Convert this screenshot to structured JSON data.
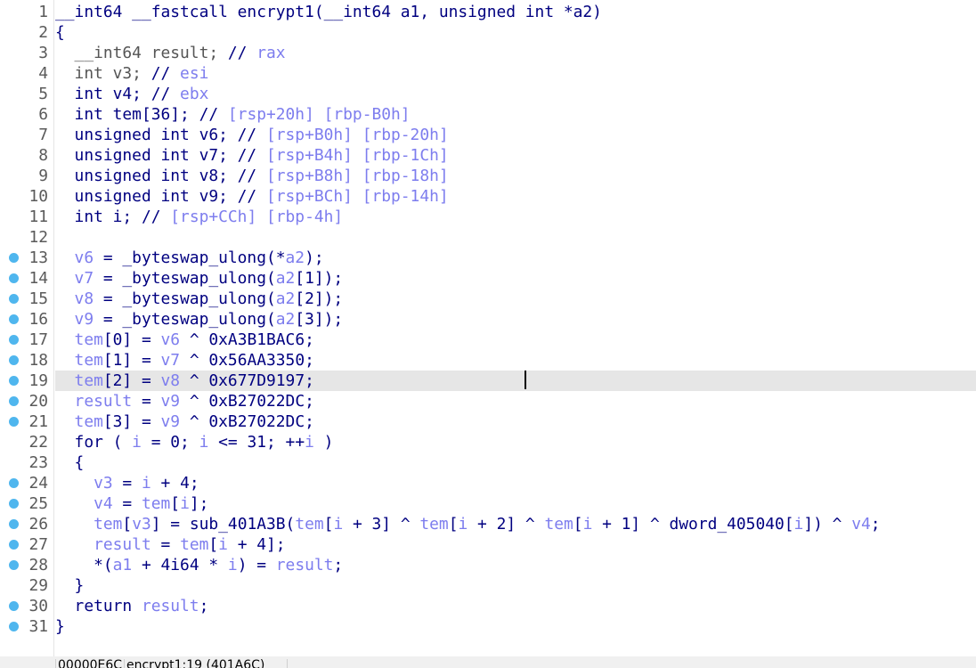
{
  "colors": {
    "code": "#000080",
    "variable": "#7d7dee",
    "line_number": "#5a5a5a",
    "breakpoint": "#4fb6ee",
    "highlight": "#e6e6e6"
  },
  "highlighted_line": 19,
  "lines": [
    {
      "n": "1",
      "dot": false,
      "t": [
        [
          "__int64 __fastcall encrypt1(__int64 a1, unsigned int *a2)",
          "k"
        ]
      ]
    },
    {
      "n": "2",
      "dot": false,
      "t": [
        [
          "{",
          "k"
        ]
      ]
    },
    {
      "n": "3",
      "dot": false,
      "t": [
        [
          "  __int64 result; ",
          "g"
        ],
        [
          "// ",
          "k"
        ],
        [
          "rax",
          "c"
        ]
      ]
    },
    {
      "n": "4",
      "dot": false,
      "t": [
        [
          "  int v3; ",
          "g"
        ],
        [
          "// ",
          "k"
        ],
        [
          "esi",
          "c"
        ]
      ]
    },
    {
      "n": "5",
      "dot": false,
      "t": [
        [
          "  int v4; ",
          "k"
        ],
        [
          "// ",
          "k"
        ],
        [
          "ebx",
          "c"
        ]
      ]
    },
    {
      "n": "6",
      "dot": false,
      "t": [
        [
          "  int tem[36]; ",
          "k"
        ],
        [
          "// ",
          "k"
        ],
        [
          "[rsp+20h] [rbp-B0h]",
          "c"
        ]
      ]
    },
    {
      "n": "7",
      "dot": false,
      "t": [
        [
          "  unsigned int v6; ",
          "k"
        ],
        [
          "// ",
          "k"
        ],
        [
          "[rsp+B0h] [rbp-20h]",
          "c"
        ]
      ]
    },
    {
      "n": "8",
      "dot": false,
      "t": [
        [
          "  unsigned int v7; ",
          "k"
        ],
        [
          "// ",
          "k"
        ],
        [
          "[rsp+B4h] [rbp-1Ch]",
          "c"
        ]
      ]
    },
    {
      "n": "9",
      "dot": false,
      "t": [
        [
          "  unsigned int v8; ",
          "k"
        ],
        [
          "// ",
          "k"
        ],
        [
          "[rsp+B8h] [rbp-18h]",
          "c"
        ]
      ]
    },
    {
      "n": "10",
      "dot": false,
      "t": [
        [
          "  unsigned int v9; ",
          "k"
        ],
        [
          "// ",
          "k"
        ],
        [
          "[rsp+BCh] [rbp-14h]",
          "c"
        ]
      ]
    },
    {
      "n": "11",
      "dot": false,
      "t": [
        [
          "  int i; ",
          "k"
        ],
        [
          "// ",
          "k"
        ],
        [
          "[rsp+CCh] [rbp-4h]",
          "c"
        ]
      ]
    },
    {
      "n": "12",
      "dot": false,
      "t": []
    },
    {
      "n": "13",
      "dot": true,
      "t": [
        [
          "  ",
          "k"
        ],
        [
          "v6",
          "v"
        ],
        [
          " = _byteswap_ulong(*",
          "k"
        ],
        [
          "a2",
          "v"
        ],
        [
          ");",
          "k"
        ]
      ]
    },
    {
      "n": "14",
      "dot": true,
      "t": [
        [
          "  ",
          "k"
        ],
        [
          "v7",
          "v"
        ],
        [
          " = _byteswap_ulong(",
          "k"
        ],
        [
          "a2",
          "v"
        ],
        [
          "[1]);",
          "k"
        ]
      ]
    },
    {
      "n": "15",
      "dot": true,
      "t": [
        [
          "  ",
          "k"
        ],
        [
          "v8",
          "v"
        ],
        [
          " = _byteswap_ulong(",
          "k"
        ],
        [
          "a2",
          "v"
        ],
        [
          "[2]);",
          "k"
        ]
      ]
    },
    {
      "n": "16",
      "dot": true,
      "t": [
        [
          "  ",
          "k"
        ],
        [
          "v9",
          "v"
        ],
        [
          " = _byteswap_ulong(",
          "k"
        ],
        [
          "a2",
          "v"
        ],
        [
          "[3]);",
          "k"
        ]
      ]
    },
    {
      "n": "17",
      "dot": true,
      "t": [
        [
          "  ",
          "k"
        ],
        [
          "tem",
          "v"
        ],
        [
          "[0] = ",
          "k"
        ],
        [
          "v6",
          "v"
        ],
        [
          " ^ 0xA3B1BAC6;",
          "k"
        ]
      ]
    },
    {
      "n": "18",
      "dot": true,
      "t": [
        [
          "  ",
          "k"
        ],
        [
          "tem",
          "v"
        ],
        [
          "[1] = ",
          "k"
        ],
        [
          "v7",
          "v"
        ],
        [
          " ^ 0x56AA3350;",
          "k"
        ]
      ]
    },
    {
      "n": "19",
      "dot": true,
      "t": [
        [
          "  ",
          "k"
        ],
        [
          "tem",
          "v"
        ],
        [
          "[2] = ",
          "k"
        ],
        [
          "v8",
          "v"
        ],
        [
          " ^ 0x677D9197;",
          "k"
        ]
      ]
    },
    {
      "n": "20",
      "dot": true,
      "t": [
        [
          "  ",
          "k"
        ],
        [
          "result",
          "v"
        ],
        [
          " = ",
          "k"
        ],
        [
          "v9",
          "v"
        ],
        [
          " ^ 0xB27022DC;",
          "k"
        ]
      ]
    },
    {
      "n": "21",
      "dot": true,
      "t": [
        [
          "  ",
          "k"
        ],
        [
          "tem",
          "v"
        ],
        [
          "[3] = ",
          "k"
        ],
        [
          "v9",
          "v"
        ],
        [
          " ^ 0xB27022DC;",
          "k"
        ]
      ]
    },
    {
      "n": "22",
      "dot": false,
      "t": [
        [
          "  for ( ",
          "k"
        ],
        [
          "i",
          "v"
        ],
        [
          " = 0; ",
          "k"
        ],
        [
          "i",
          "v"
        ],
        [
          " <= 31; ++",
          "k"
        ],
        [
          "i",
          "v"
        ],
        [
          " )",
          "k"
        ]
      ]
    },
    {
      "n": "23",
      "dot": false,
      "t": [
        [
          "  {",
          "k"
        ]
      ]
    },
    {
      "n": "24",
      "dot": true,
      "t": [
        [
          "    ",
          "k"
        ],
        [
          "v3",
          "v"
        ],
        [
          " = ",
          "k"
        ],
        [
          "i",
          "v"
        ],
        [
          " + 4;",
          "k"
        ]
      ]
    },
    {
      "n": "25",
      "dot": true,
      "t": [
        [
          "    ",
          "k"
        ],
        [
          "v4",
          "v"
        ],
        [
          " = ",
          "k"
        ],
        [
          "tem",
          "v"
        ],
        [
          "[",
          "k"
        ],
        [
          "i",
          "v"
        ],
        [
          "];",
          "k"
        ]
      ]
    },
    {
      "n": "26",
      "dot": true,
      "t": [
        [
          "    ",
          "k"
        ],
        [
          "tem",
          "v"
        ],
        [
          "[",
          "k"
        ],
        [
          "v3",
          "v"
        ],
        [
          "] = sub_401A3B(",
          "k"
        ],
        [
          "tem",
          "v"
        ],
        [
          "[",
          "k"
        ],
        [
          "i",
          "v"
        ],
        [
          " + 3] ^ ",
          "k"
        ],
        [
          "tem",
          "v"
        ],
        [
          "[",
          "k"
        ],
        [
          "i",
          "v"
        ],
        [
          " + 2] ^ ",
          "k"
        ],
        [
          "tem",
          "v"
        ],
        [
          "[",
          "k"
        ],
        [
          "i",
          "v"
        ],
        [
          " + 1] ^ dword_405040[",
          "k"
        ],
        [
          "i",
          "v"
        ],
        [
          "]) ^ ",
          "k"
        ],
        [
          "v4",
          "v"
        ],
        [
          ";",
          "k"
        ]
      ]
    },
    {
      "n": "27",
      "dot": true,
      "t": [
        [
          "    ",
          "k"
        ],
        [
          "result",
          "v"
        ],
        [
          " = ",
          "k"
        ],
        [
          "tem",
          "v"
        ],
        [
          "[",
          "k"
        ],
        [
          "i",
          "v"
        ],
        [
          " + 4];",
          "k"
        ]
      ]
    },
    {
      "n": "28",
      "dot": true,
      "t": [
        [
          "    *(",
          "k"
        ],
        [
          "a1",
          "v"
        ],
        [
          " + 4i64 * ",
          "k"
        ],
        [
          "i",
          "v"
        ],
        [
          ") = ",
          "k"
        ],
        [
          "result",
          "v"
        ],
        [
          ";",
          "k"
        ]
      ]
    },
    {
      "n": "29",
      "dot": false,
      "t": [
        [
          "  }",
          "k"
        ]
      ]
    },
    {
      "n": "30",
      "dot": true,
      "t": [
        [
          "  return ",
          "k"
        ],
        [
          "result",
          "v"
        ],
        [
          ";",
          "k"
        ]
      ]
    },
    {
      "n": "31",
      "dot": true,
      "t": [
        [
          "}",
          "k"
        ]
      ]
    }
  ],
  "status": {
    "offset": "00000E6C",
    "location": "encrypt1:19 (401A6C)"
  }
}
